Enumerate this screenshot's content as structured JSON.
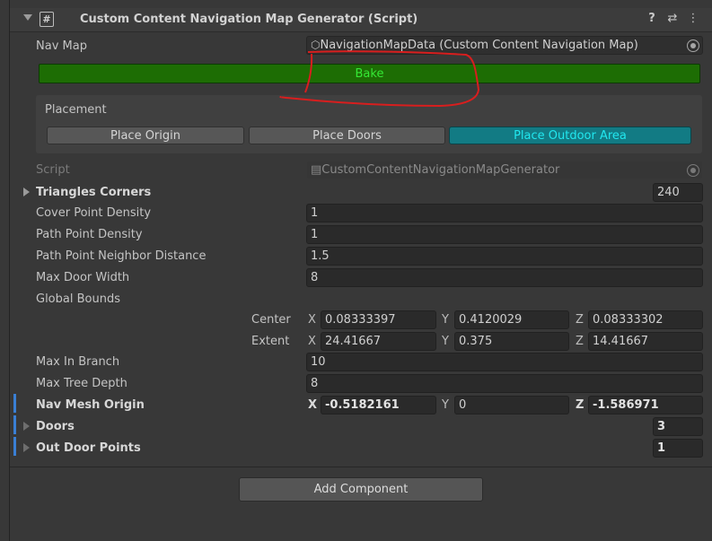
{
  "component": {
    "title": "Custom Content Navigation Map Generator (Script)",
    "script_icon": "#",
    "help_icon": "?",
    "settings_icon": "⇄",
    "menu_icon": "⋮"
  },
  "nav_map": {
    "label": "Nav Map",
    "value": "NavigationMapData (Custom Content Navigation Map)"
  },
  "bake_button": "Bake",
  "placement": {
    "label": "Placement",
    "buttons": [
      "Place Origin",
      "Place Doors",
      "Place Outdoor Area"
    ]
  },
  "script": {
    "label": "Script",
    "value": "CustomContentNavigationMapGenerator"
  },
  "triangles_corners": {
    "label": "Triangles Corners",
    "value": "240"
  },
  "cover_point_density": {
    "label": "Cover Point Density",
    "value": "1"
  },
  "path_point_density": {
    "label": "Path Point Density",
    "value": "1"
  },
  "path_point_neighbor_distance": {
    "label": "Path Point Neighbor Distance",
    "value": "1.5"
  },
  "max_door_width": {
    "label": "Max Door Width",
    "value": "8"
  },
  "global_bounds": {
    "label": "Global Bounds",
    "center": {
      "label": "Center",
      "x": "0.08333397",
      "y": "0.4120029",
      "z": "0.08333302"
    },
    "extent": {
      "label": "Extent",
      "x": "24.41667",
      "y": "0.375",
      "z": "14.41667"
    }
  },
  "axes": {
    "x": "X",
    "y": "Y",
    "z": "Z"
  },
  "max_in_branch": {
    "label": "Max In Branch",
    "value": "10"
  },
  "max_tree_depth": {
    "label": "Max Tree Depth",
    "value": "8"
  },
  "nav_mesh_origin": {
    "label": "Nav Mesh Origin",
    "x": "-0.5182161",
    "y": "0",
    "z": "-1.586971"
  },
  "doors": {
    "label": "Doors",
    "value": "3"
  },
  "out_door_points": {
    "label": "Out Door Points",
    "value": "1"
  },
  "add_component_button": "Add Component",
  "colors": {
    "bake_bg": "#1d6d04",
    "bake_text": "#35e835",
    "outdoor_bg": "#127b84",
    "outdoor_text": "#21e7ef",
    "annotation": "#d81e1e",
    "modified_bar": "#3a7fd4"
  }
}
